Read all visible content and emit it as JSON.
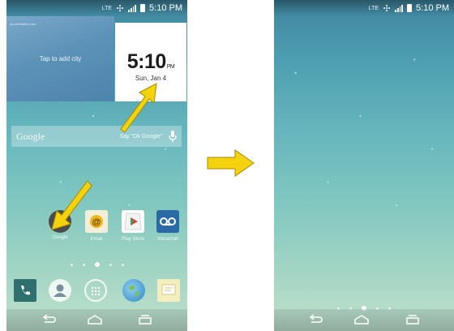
{
  "status_bar": {
    "network": "LTE",
    "time": "5:10 PM"
  },
  "weather_widget": {
    "brand": "AccuWeather.com",
    "prompt": "Tap to add city"
  },
  "clock_widget": {
    "time": "5:10",
    "ampm": "PM",
    "date": "Sun, Jan 4"
  },
  "google_search": {
    "logo": "Google",
    "hint": "Say \"Ok Google\""
  },
  "apps": [
    {
      "label": "Google"
    },
    {
      "label": "Email"
    },
    {
      "label": "Play Store"
    },
    {
      "label": "Voicemail"
    }
  ],
  "home_screens": {
    "left_active_page": 3,
    "right_active_page": 3,
    "page_count": 5
  },
  "colors": {
    "highlight_arrow": "#f5d20e",
    "arrow_outline": "#a88a00"
  }
}
